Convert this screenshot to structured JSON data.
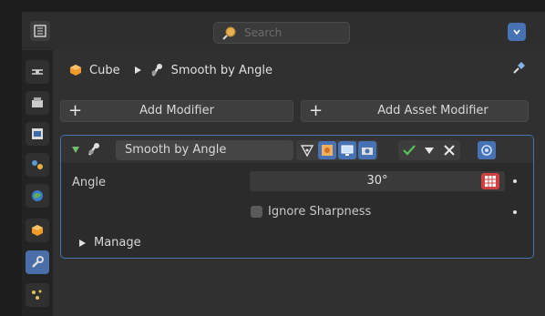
{
  "header": {
    "search_placeholder": "Search"
  },
  "breadcrumb": {
    "object": "Cube",
    "modifier": "Smooth by Angle"
  },
  "buttons": {
    "add_modifier": "Add Modifier",
    "add_asset_modifier": "Add Asset Modifier"
  },
  "modifier": {
    "name": "Smooth by Angle",
    "angle_label": "Angle",
    "angle_value": "30°",
    "ignore_sharpness_label": "Ignore Sharpness",
    "ignore_sharpness_checked": false,
    "manage_label": "Manage"
  },
  "tabs": [
    {
      "icon": "tool-icon"
    },
    {
      "icon": "render-icon"
    },
    {
      "icon": "output-icon"
    },
    {
      "icon": "view-layer-icon"
    },
    {
      "icon": "scene-icon"
    },
    {
      "icon": "world-icon"
    },
    {
      "icon": "object-icon"
    },
    {
      "icon": "modifiers-icon",
      "active": true
    },
    {
      "icon": "particles-icon"
    }
  ],
  "colors": {
    "accent": "#4772b3",
    "panel": "#303030",
    "outline": "#4772b3"
  }
}
